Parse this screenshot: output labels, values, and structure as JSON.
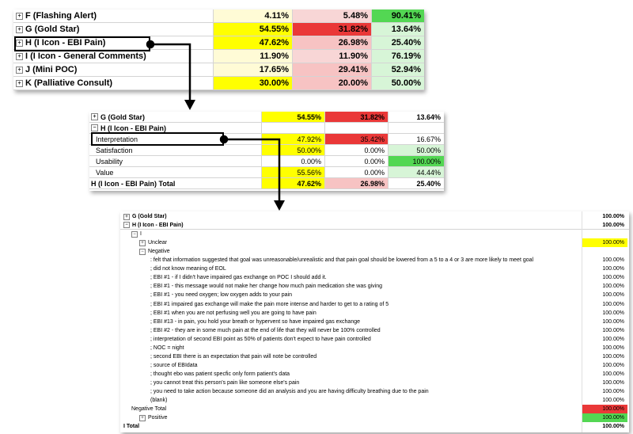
{
  "panel1": {
    "rows": [
      {
        "label": "F (Flashing Alert)",
        "v": [
          "4.11%",
          "5.48%",
          "90.41%"
        ],
        "c": [
          "ly",
          "pink",
          "g"
        ]
      },
      {
        "label": "G (Gold Star)",
        "v": [
          "54.55%",
          "31.82%",
          "13.64%"
        ],
        "c": [
          "y",
          "r",
          "lg"
        ]
      },
      {
        "label": "H (I Icon - EBI Pain)",
        "v": [
          "47.62%",
          "26.98%",
          "25.40%"
        ],
        "c": [
          "y",
          "lr",
          "lg"
        ]
      },
      {
        "label": "I (I Icon - General Comments)",
        "v": [
          "11.90%",
          "11.90%",
          "76.19%"
        ],
        "c": [
          "ly",
          "pink",
          "lg"
        ]
      },
      {
        "label": "J (Mini POC)",
        "v": [
          "17.65%",
          "29.41%",
          "52.94%"
        ],
        "c": [
          "ly",
          "lr",
          "lg"
        ]
      },
      {
        "label": "K (Palliative Consult)",
        "v": [
          "30.00%",
          "20.00%",
          "50.00%"
        ],
        "c": [
          "y",
          "lr",
          "lg"
        ]
      }
    ]
  },
  "panel2": {
    "rows": [
      {
        "label": "G (Gold Star)",
        "v": [
          "54.55%",
          "31.82%",
          "13.64%"
        ],
        "c": [
          "y",
          "r",
          ""
        ],
        "bold": true,
        "pm": true
      },
      {
        "label": "H (I Icon - EBI Pain)",
        "v": [
          "",
          "",
          ""
        ],
        "c": [
          "",
          "",
          ""
        ],
        "bold": true,
        "pm": true
      },
      {
        "label": "Interpretation",
        "v": [
          "47.92%",
          "35.42%",
          "16.67%"
        ],
        "c": [
          "y",
          "r",
          ""
        ],
        "indent": true
      },
      {
        "label": "Satisfaction",
        "v": [
          "50.00%",
          "0.00%",
          "50.00%"
        ],
        "c": [
          "y",
          "",
          "lg"
        ],
        "indent": true
      },
      {
        "label": "Usability",
        "v": [
          "0.00%",
          "0.00%",
          "100.00%"
        ],
        "c": [
          "",
          "",
          "g"
        ],
        "indent": true
      },
      {
        "label": "Value",
        "v": [
          "55.56%",
          "0.00%",
          "44.44%"
        ],
        "c": [
          "y",
          "",
          "lg"
        ],
        "indent": true
      },
      {
        "label": "H (I Icon - EBI Pain) Total",
        "v": [
          "47.62%",
          "26.98%",
          "25.40%"
        ],
        "c": [
          "y",
          "lr",
          ""
        ],
        "bold": true
      }
    ]
  },
  "panel3": {
    "rows": [
      {
        "label": "G (Gold Star)",
        "v": "100.00%",
        "lvl": 0,
        "pm": true,
        "bold": true,
        "c": ""
      },
      {
        "label": "H (I Icon - EBI Pain)",
        "v": "100.00%",
        "lvl": 0,
        "pm": true,
        "bold": true,
        "c": ""
      },
      {
        "label": "I",
        "v": "",
        "lvl": 1,
        "pm": true,
        "c": ""
      },
      {
        "label": "Unclear",
        "v": "100.00%",
        "lvl": 2,
        "pm": true,
        "c": "y"
      },
      {
        "label": "Negative",
        "v": "",
        "lvl": 2,
        "pm": true,
        "c": ""
      },
      {
        "label": ": felt that information suggested that goal was unreasonable/unrealistic and that pain goal should be lowered from a 5 to a 4 or 3 are more likely to meet goal",
        "v": "100.00%",
        "lvl": 3,
        "c": ""
      },
      {
        "label": "; did not know meaning of EOL",
        "v": "100.00%",
        "lvl": 3,
        "c": ""
      },
      {
        "label": "; EBI #1 - if I didn't have impaired gas exchange on POC I should add it.",
        "v": "100.00%",
        "lvl": 3,
        "c": ""
      },
      {
        "label": "; EBI #1 - this message would not make her change how much pain medication she was giving",
        "v": "100.00%",
        "lvl": 3,
        "c": ""
      },
      {
        "label": "; EBI #1 - you need oxygen; low oxygen adds to your pain",
        "v": "100.00%",
        "lvl": 3,
        "c": ""
      },
      {
        "label": "; EBI #1 impaired gas exchange will make the pain more intense and harder to get to a rating of 5",
        "v": "100.00%",
        "lvl": 3,
        "c": ""
      },
      {
        "label": "; EBI #1 when you are not perfusing well you are going to have pain",
        "v": "100.00%",
        "lvl": 3,
        "c": ""
      },
      {
        "label": "; EBI #13 - in pain, you hold your breath or hypervent so have impaired gas exchange",
        "v": "100.00%",
        "lvl": 3,
        "c": ""
      },
      {
        "label": "; EBI #2 - they are in some much pain at the end of life that they will never be 100% controlled",
        "v": "100.00%",
        "lvl": 3,
        "c": ""
      },
      {
        "label": "; interpretation of second EBI point as 50% of patients don't expect to have pain controlled",
        "v": "100.00%",
        "lvl": 3,
        "c": ""
      },
      {
        "label": "; NOC = night",
        "v": "100.00%",
        "lvl": 3,
        "c": ""
      },
      {
        "label": "; second EBI there is an expectation that pain will note be controlled",
        "v": "100.00%",
        "lvl": 3,
        "c": ""
      },
      {
        "label": "; source of EBIdata",
        "v": "100.00%",
        "lvl": 3,
        "c": ""
      },
      {
        "label": "; thought ebo was patient specfic only form patient's data",
        "v": "100.00%",
        "lvl": 3,
        "c": ""
      },
      {
        "label": "; you cannot treat this person's pain like someone else's pain",
        "v": "100.00%",
        "lvl": 3,
        "c": ""
      },
      {
        "label": "; you need to take action because someone did an analysis and you are having difficulty breathing due to the pain",
        "v": "100.00%",
        "lvl": 3,
        "c": ""
      },
      {
        "label": "(blank)",
        "v": "100.00%",
        "lvl": 3,
        "c": ""
      },
      {
        "label": "Negative Total",
        "v": "100.00%",
        "lvl": 1,
        "c": "r"
      },
      {
        "label": "Positive",
        "v": "100.00%",
        "lvl": 2,
        "pm": true,
        "c": "g"
      },
      {
        "label": "I Total",
        "v": "100.00%",
        "lvl": 0,
        "bold": true,
        "c": ""
      }
    ]
  }
}
